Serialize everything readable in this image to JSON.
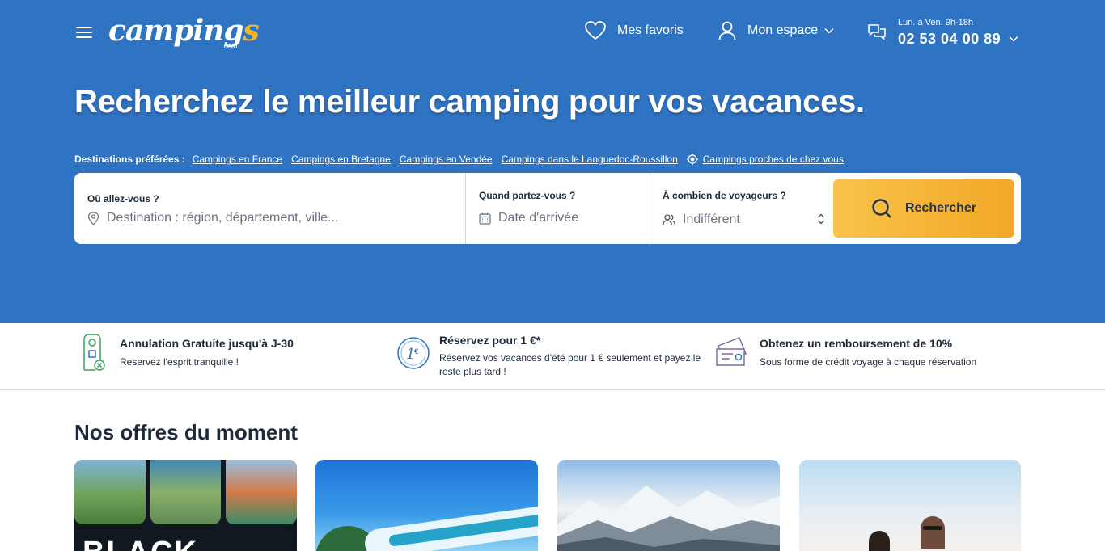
{
  "header": {
    "logo_text": "camping",
    "logo_accent": "s",
    "logo_sub": ".com",
    "favorites_label": "Mes favoris",
    "account_label": "Mon espace",
    "phone_hours": "Lun. à Ven. 9h-18h",
    "phone_number": "02 53 04 00 89"
  },
  "hero": {
    "headline": "Recherchez le meilleur camping pour vos vacances.",
    "destinations_title": "Destinations préférées :",
    "destinations": [
      "Campings en France",
      "Campings en Bretagne",
      "Campings en Vendée",
      "Campings dans le Languedoc-Roussillon"
    ],
    "nearby_label": "Campings proches de chez vous"
  },
  "search": {
    "where_label": "Où allez-vous ?",
    "where_placeholder": "Destination : région, département, ville...",
    "when_label": "Quand partez-vous ?",
    "when_placeholder": "Date d'arrivée",
    "who_label": "À combien de voyageurs ?",
    "who_value": "Indifférent",
    "button_label": "Rechercher"
  },
  "advantages": [
    {
      "title": "Annulation Gratuite jusqu'à J-30",
      "subtitle": "Reservez l'esprit tranquille !",
      "icon": "door-hanger-icon"
    },
    {
      "title": "Réservez pour 1 €*",
      "subtitle": "Réservez vos vacances d'été pour 1 € seulement et payez le reste plus tard !",
      "icon": "one-euro-coin-icon"
    },
    {
      "title": "Obtenez un remboursement de 10%",
      "subtitle": "Sous forme de crédit voyage à chaque réservation",
      "icon": "voucher-icon"
    }
  ],
  "offers": {
    "title_regular": "Nos offres ",
    "title_bold": "du moment",
    "card1_text": "BLACK"
  },
  "colors": {
    "brand_blue": "#2f73c3",
    "accent_yellow": "#f6b428",
    "button_gradient_start": "#f8c34b",
    "button_gradient_end": "#f3a826",
    "text_dark": "#1d2a3a"
  }
}
